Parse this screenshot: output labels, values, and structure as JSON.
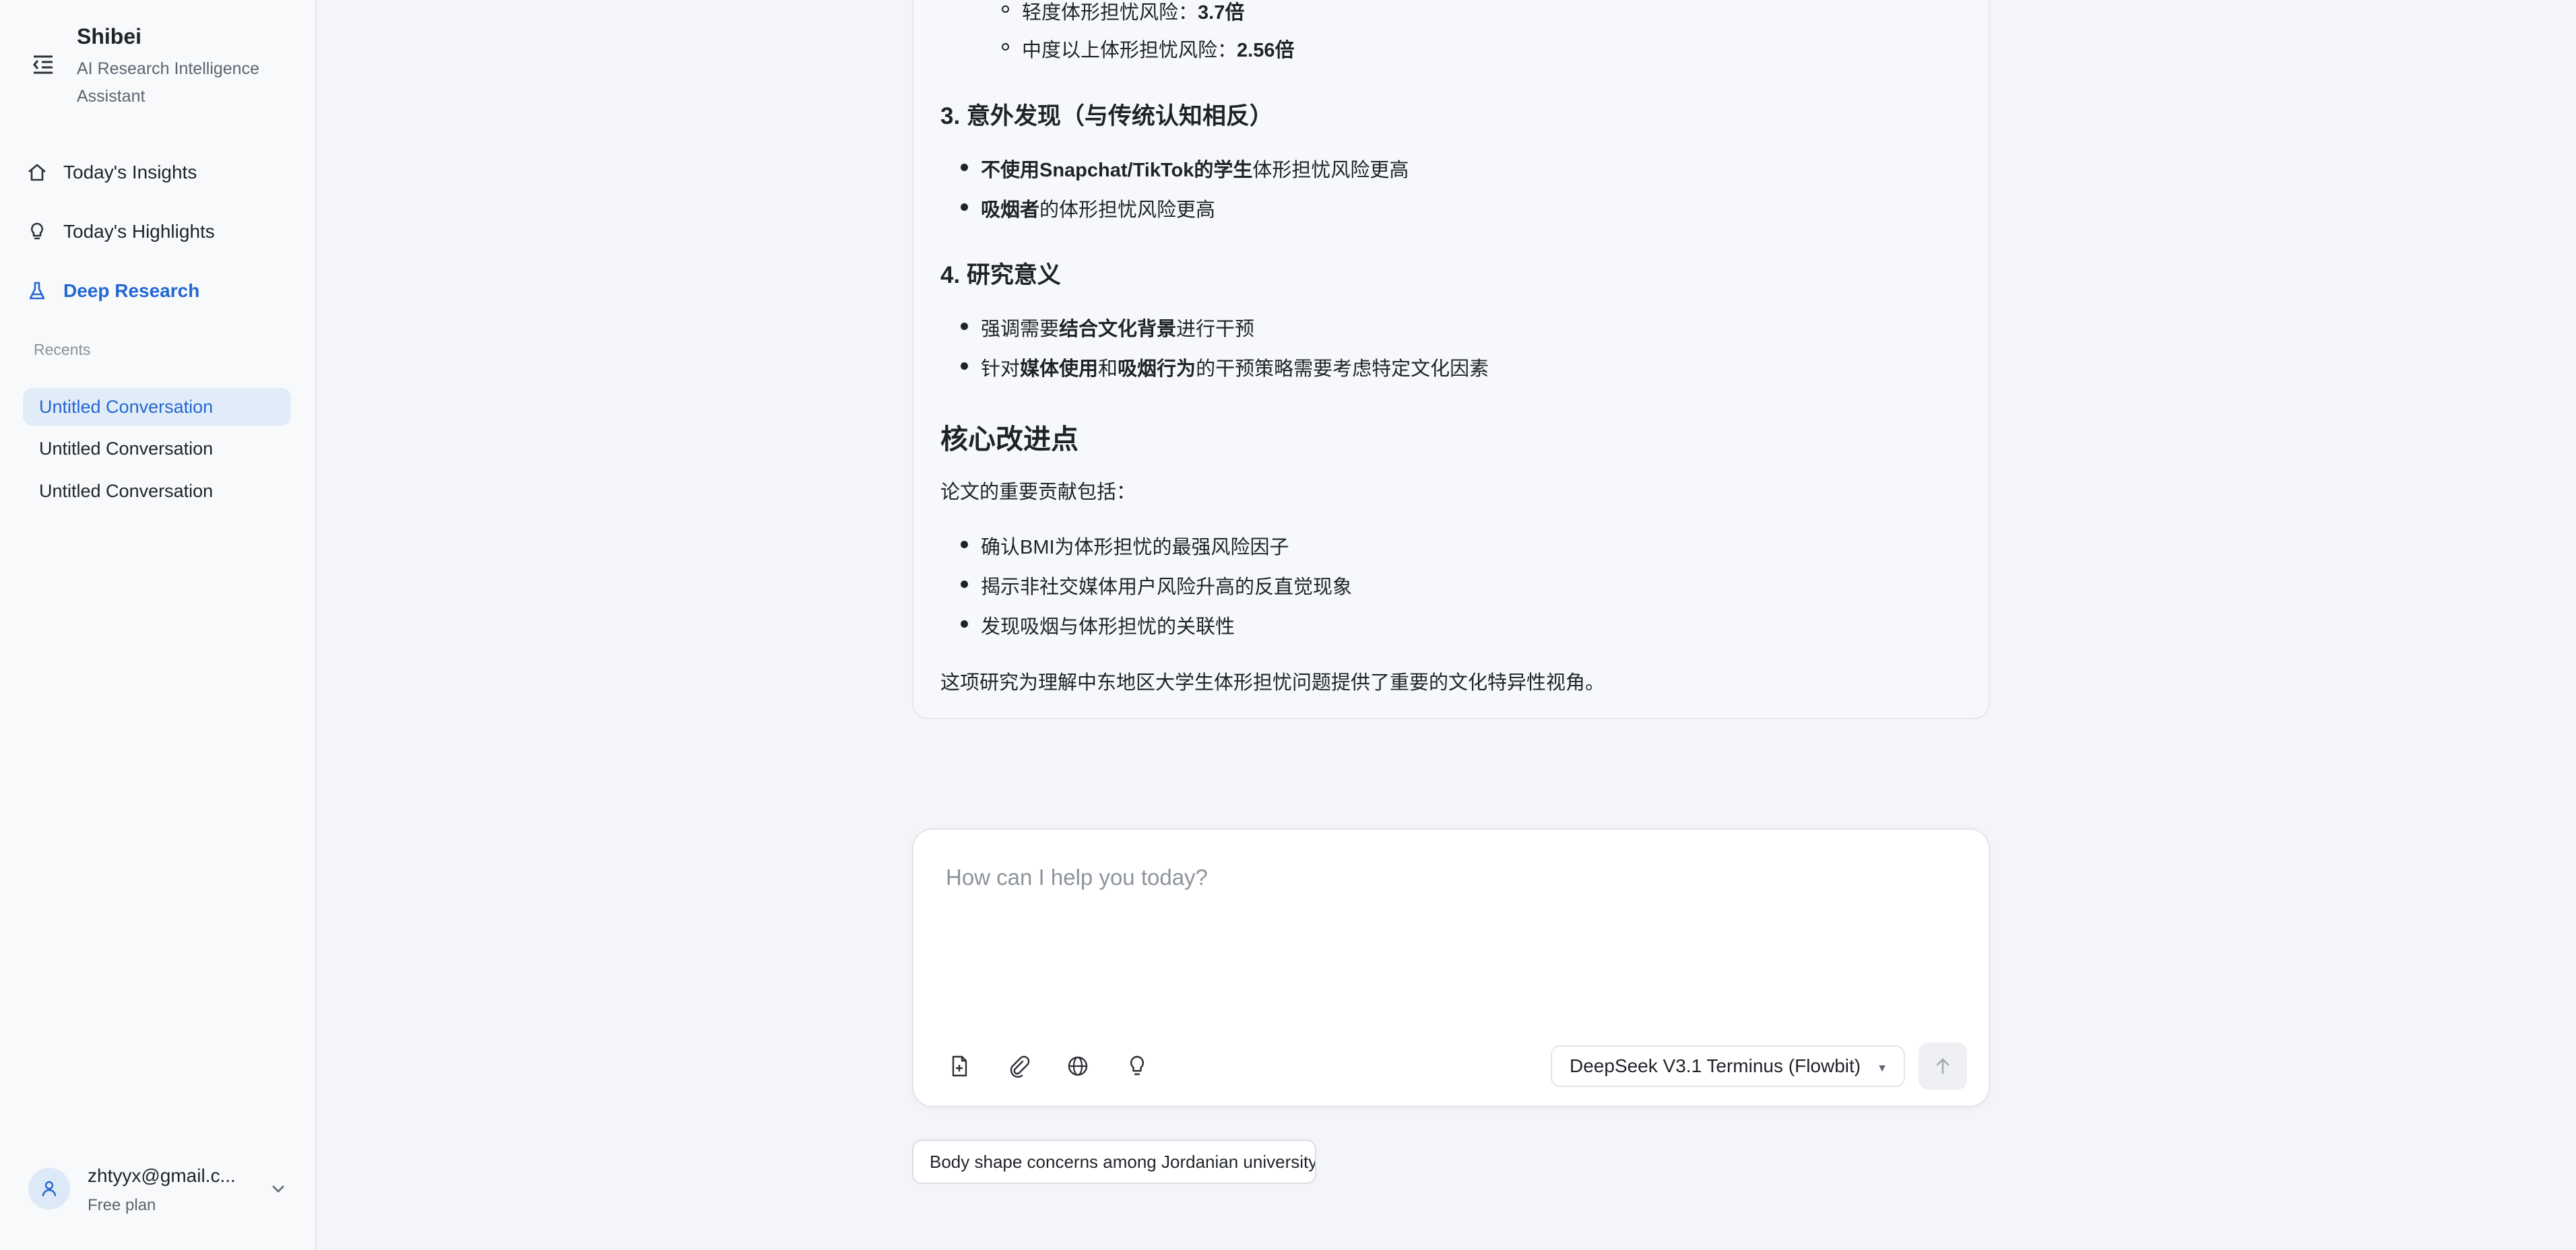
{
  "sidebar": {
    "brand_title": "Shibei",
    "brand_subtitle": "AI Research Intelligence Assistant",
    "nav": [
      {
        "label": "Today's Insights",
        "icon": "home-icon"
      },
      {
        "label": "Today's Highlights",
        "icon": "lightbulb-icon"
      },
      {
        "label": "Deep Research",
        "icon": "flask-icon",
        "active": true
      }
    ],
    "recents_label": "Recents",
    "conversations": [
      {
        "label": "Untitled Conversation",
        "active": true
      },
      {
        "label": "Untitled Conversation"
      },
      {
        "label": "Untitled Conversation"
      }
    ],
    "user": {
      "email": "zhtyyx@gmail.c...",
      "plan": "Free plan"
    }
  },
  "answer": {
    "sub1_label": "轻度体形担忧风险：",
    "sub1_value": "3.7倍",
    "sub2_label": "中度以上体形担忧风险：",
    "sub2_value": "2.56倍",
    "s3_title": "3. 意外发现（与传统认知相反）",
    "s3_b1_bold": "不使用Snapchat/TikTok的学生",
    "s3_b1_rest": "体形担忧风险更高",
    "s3_b2_bold": "吸烟者",
    "s3_b2_rest": "的体形担忧风险更高",
    "s4_title": "4. 研究意义",
    "s4_b1_pre": "强调需要",
    "s4_b1_bold": "结合文化背景",
    "s4_b1_post": "进行干预",
    "s4_b2_pre": "针对",
    "s4_b2_bold1": "媒体使用",
    "s4_b2_mid": "和",
    "s4_b2_bold2": "吸烟行为",
    "s4_b2_post": "的干预策略需要考虑特定文化因素",
    "core_title": "核心改进点",
    "core_intro": "论文的重要贡献包括：",
    "core_bullets": [
      "确认BMI为体形担忧的最强风险因子",
      "揭示非社交媒体用户风险升高的反直觉现象",
      "发现吸烟与体形担忧的关联性"
    ],
    "conclusion": "这项研究为理解中东地区大学生体形担忧问题提供了重要的文化特异性视角。"
  },
  "composer": {
    "placeholder": "How can I help you today?",
    "model": "DeepSeek V3.1 Terminus (Flowbit)",
    "tools": [
      "file-plus-icon",
      "paperclip-icon",
      "globe-icon",
      "lightbulb-icon"
    ]
  },
  "suggestion_chip": "Body shape concerns among Jordanian university students"
}
